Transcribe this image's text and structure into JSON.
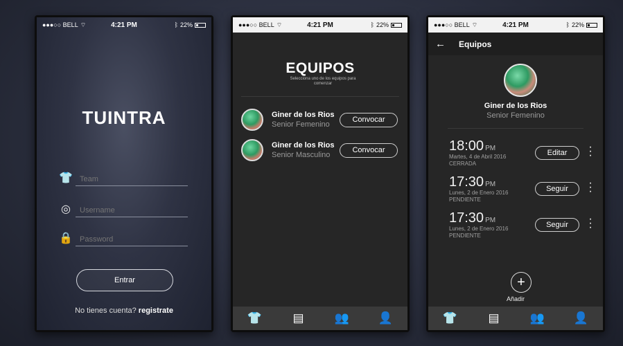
{
  "statusbar": {
    "carrier": "●●●○○ BELL",
    "wifi_icon": "wifi-icon",
    "time": "4:21 PM",
    "bluetooth_icon": "bluetooth-icon",
    "battery": "22%"
  },
  "login": {
    "logo": "TUINTRA",
    "team_placeholder": "Team",
    "username_placeholder": "Username",
    "password_placeholder": "Password",
    "enter_button": "Entrar",
    "signup_prompt": "No tienes cuenta?",
    "signup_link": "registrate"
  },
  "teams": {
    "title": "EQUIPOS",
    "subtitle": "Selecciona uno de los equipos para comenzar",
    "items": [
      {
        "name": "Giner de los Rios",
        "category": "Senior Femenino",
        "action": "Convocar"
      },
      {
        "name": "Giner de los Rios",
        "category": "Senior Masculino",
        "action": "Convocar"
      }
    ]
  },
  "detail": {
    "nav_title": "Equipos",
    "club_name": "Giner de los Rios",
    "club_category": "Senior Femenino",
    "events": [
      {
        "time": "18:00",
        "ampm": "PM",
        "date": "Martes, 4 de Abril 2016",
        "status": "CERRADA",
        "action": "Editar"
      },
      {
        "time": "17:30",
        "ampm": "PM",
        "date": "Lunes, 2 de Enero 2016",
        "status": "PENDIENTE",
        "action": "Seguir"
      },
      {
        "time": "17:30",
        "ampm": "PM",
        "date": "Lunes, 2 de Enero 2016",
        "status": "PENDIENTE",
        "action": "Seguir"
      }
    ],
    "add_label": "Añadir"
  },
  "tabbar": {
    "tabs": [
      "jersey-icon",
      "clipboard-icon",
      "group-icon",
      "person-icon"
    ]
  },
  "colors": {
    "background": "#2a2e3d",
    "screen_dark": "#262626",
    "tabbar": "#3a3a3a",
    "accent_white": "#ffffff"
  }
}
